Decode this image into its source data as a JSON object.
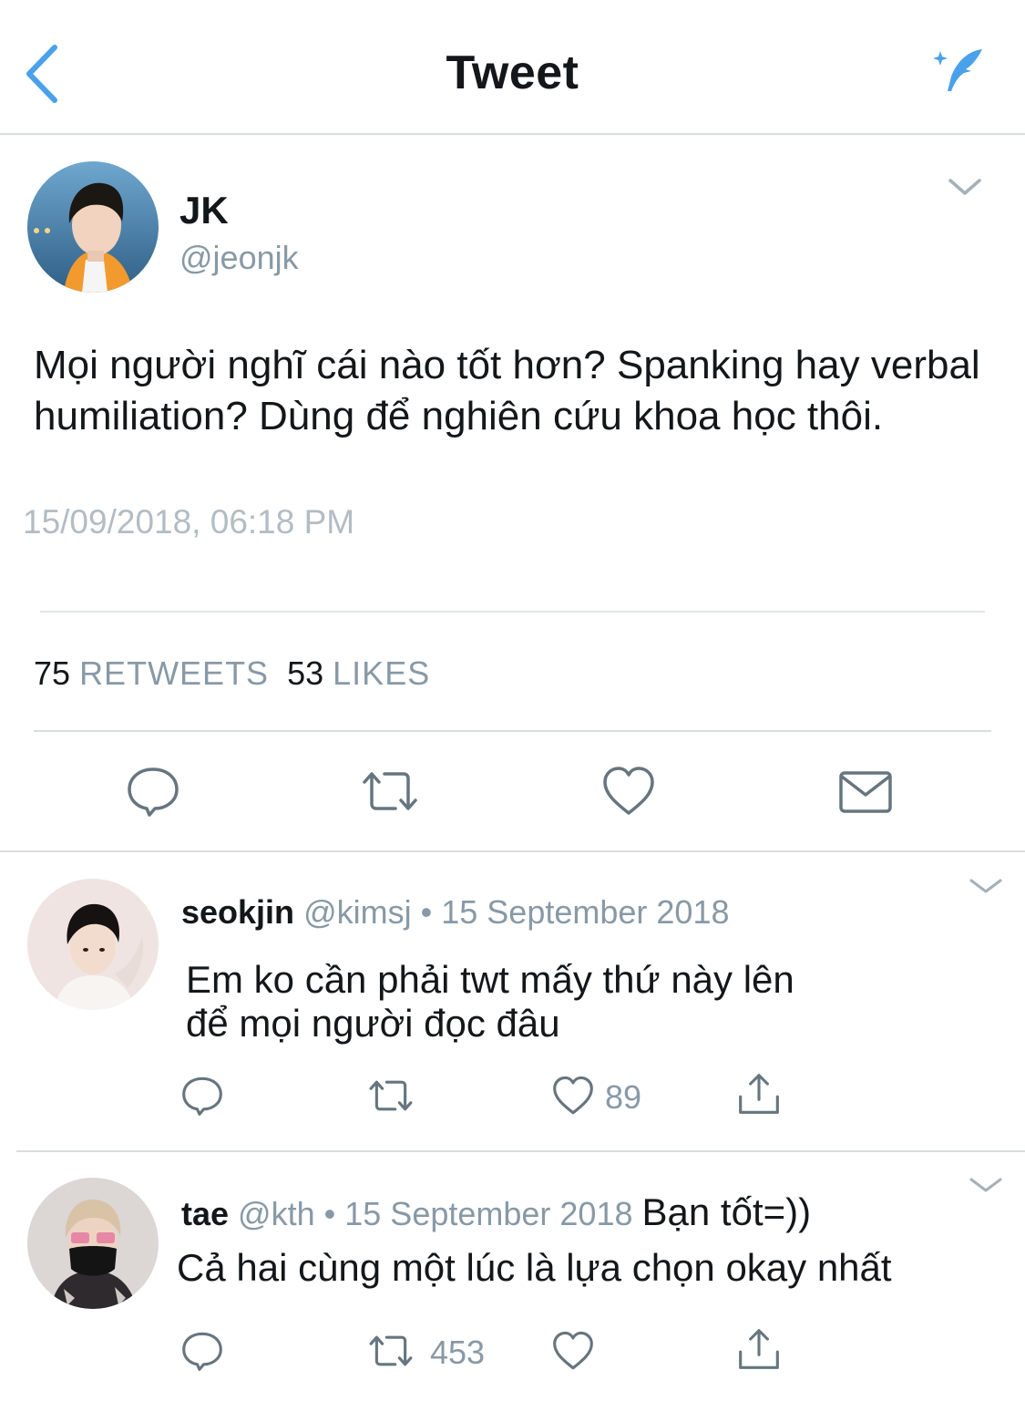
{
  "header": {
    "title": "Tweet",
    "accent_color": "#4aa1eb",
    "back_icon": "chevron-left-icon",
    "compose_icon": "compose-feather-icon"
  },
  "tweet": {
    "name": "JK",
    "handle": "@jeonjk",
    "text": "Mọi người nghĩ cái nào tốt hơn? Spanking hay verbal humiliation? Dùng để nghiên cứu khoa học thôi.",
    "timestamp": "15/09/2018, 06:18 PM",
    "retweets_count": "75",
    "retweets_label": "RETWEETS",
    "likes_count": "53",
    "likes_label": "LIKES",
    "actions": [
      "reply-icon",
      "retweet-icon",
      "like-icon",
      "message-icon"
    ]
  },
  "replies": [
    {
      "name": "seokjin",
      "handle": "@kimsj",
      "separator": "•",
      "date": "15 September 2018",
      "text_line1": "Em ko cần phải twt mấy thứ này lên",
      "text_line2": "để mọi người đọc đâu",
      "likes": "89",
      "retweets": ""
    },
    {
      "name": "tae",
      "handle": "@kth",
      "separator": "•",
      "date": "15 September 2018",
      "inline_text": "Bạn tốt=))",
      "text": "Cả hai cùng một lúc là lựa chọn okay nhất",
      "likes": "",
      "retweets": "453"
    }
  ]
}
